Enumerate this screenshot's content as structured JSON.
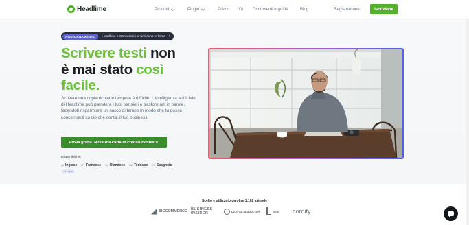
{
  "nav": {
    "logo": "Headlime",
    "links": [
      {
        "label": "Prodotti",
        "has_dropdown": true
      },
      {
        "label": "Plugin",
        "has_dropdown": true
      },
      {
        "label": "Prezzi",
        "has_dropdown": false
      },
      {
        "label": "Di",
        "has_dropdown": false
      },
      {
        "label": "Documenti e guide",
        "has_dropdown": false
      },
      {
        "label": "Blog",
        "has_dropdown": false
      }
    ],
    "register": "Registrazione",
    "cta": "Iscrizione"
  },
  "badge": {
    "tag": "AGGIORNAMENTO",
    "text": "Headlime e Conversion si uniscono le forze",
    "arrow": "›"
  },
  "hero": {
    "title_line1_green": "Scrivere testi",
    "title_line1_dark": " non",
    "title_line2_dark": "è mai stato ",
    "title_line2_green": "così",
    "title_line3_green": "facile.",
    "description": "Scrivere una copia richiede tempo e è difficile. L'intelligenza artificiale di Headlime può prendere i tuoi pensieri e trasformarli in parole, facendoti risparmiare un sacco di tempo in modo che tu possa concentrarti su ciò che conta: il tuo business!",
    "cta": "Prova gratis. Nessuna carta di credito richiesta.",
    "available_label": "Disponibile in",
    "languages": [
      {
        "code": "gb",
        "name": "Inglese"
      },
      {
        "code": "FR",
        "name": "Francese"
      },
      {
        "code": "NL",
        "name": "Olandese"
      },
      {
        "code": "DE",
        "name": "Tedesco"
      },
      {
        "code": "ES",
        "name": "Spagnolo"
      }
    ],
    "more_languages": "+4 in più"
  },
  "trusted": {
    "label": "Scelto e utilizzato da oltre 1.102 aziende",
    "brands": [
      "BIGCOMMERCE",
      "BUSINESS INSIDER",
      "DIGITAL MARKETER",
      "Tank",
      "cordify"
    ]
  },
  "colors": {
    "brand_green": "#6cc13d",
    "cta_green": "#3a8d2b",
    "nav_cta_green": "#55b12d",
    "badge_purple": "#5b62d6"
  },
  "icons": {
    "chat": "chat-bubble-icon",
    "dropdown": "chevron-down-icon"
  }
}
